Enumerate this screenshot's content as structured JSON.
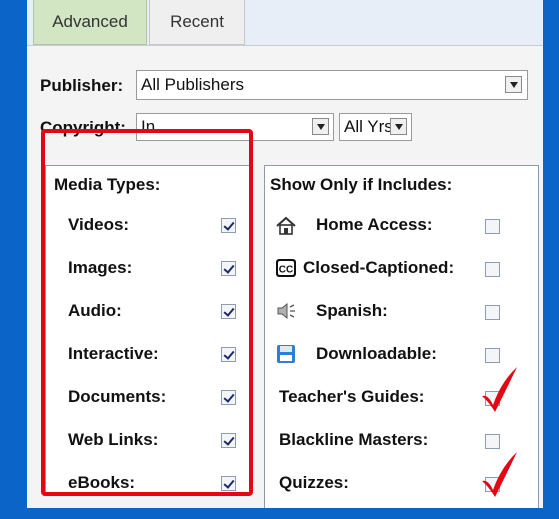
{
  "tabs": [
    {
      "label": "Advanced",
      "active": true
    },
    {
      "label": "Recent",
      "active": false
    }
  ],
  "publisher": {
    "label": "Publisher:",
    "value": "All Publishers"
  },
  "copyright": {
    "label": "Copyright:",
    "value": "In",
    "years_value": "All Yrs."
  },
  "media_types": {
    "title": "Media Types:",
    "items": [
      {
        "label": "Videos:",
        "checked": true
      },
      {
        "label": "Images:",
        "checked": true
      },
      {
        "label": "Audio:",
        "checked": true
      },
      {
        "label": "Interactive:",
        "checked": true
      },
      {
        "label": "Documents:",
        "checked": true
      },
      {
        "label": "Web Links:",
        "checked": true
      },
      {
        "label": "eBooks:",
        "checked": true
      }
    ]
  },
  "show_only": {
    "title": "Show Only if Includes:",
    "items": [
      {
        "label": "Home Access:",
        "icon": "home-icon",
        "checked": false
      },
      {
        "label": "Closed-Captioned:",
        "icon": "cc-icon",
        "checked": false
      },
      {
        "label": "Spanish:",
        "icon": "speaker-icon",
        "checked": false
      },
      {
        "label": "Downloadable:",
        "icon": "floppy-disk-icon",
        "checked": false
      },
      {
        "label": "Teacher's Guides:",
        "icon": "",
        "checked": false
      },
      {
        "label": "Blackline Masters:",
        "icon": "",
        "checked": false
      },
      {
        "label": "Quizzes:",
        "icon": "",
        "checked": false
      }
    ]
  },
  "colors": {
    "frame": "#0b64c8",
    "highlight": "#e30613",
    "tab_active": "#d2e6c4"
  }
}
